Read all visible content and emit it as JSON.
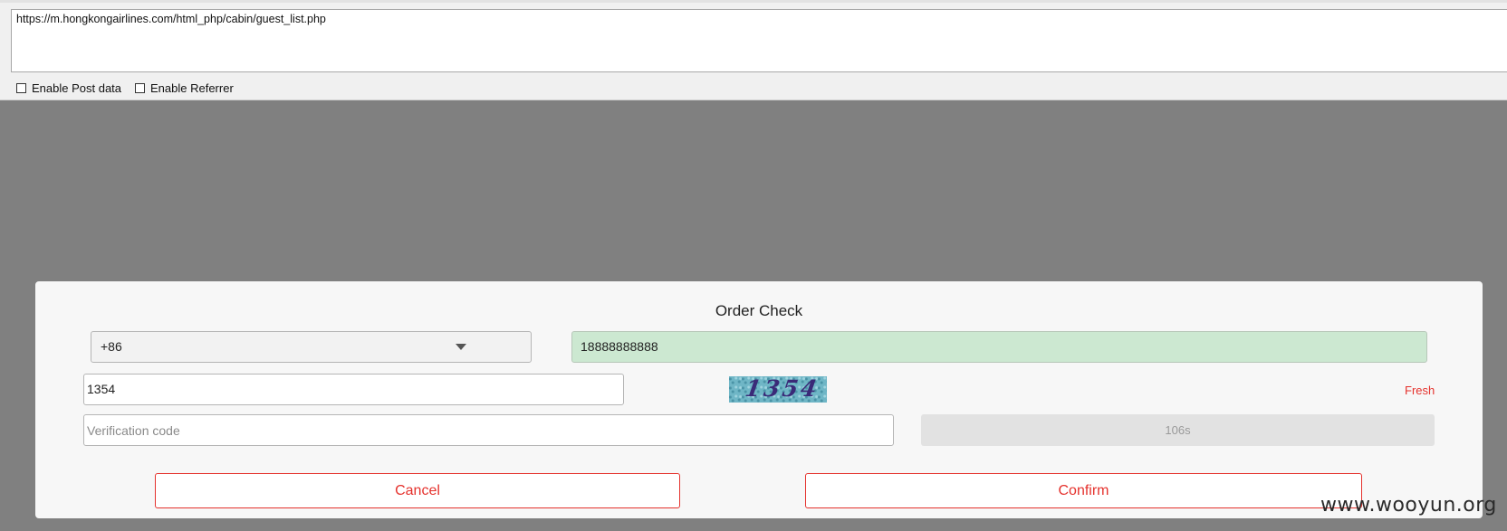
{
  "toolbar": {
    "url": "https://m.hongkongairlines.com/html_php/cabin/guest_list.php",
    "enable_post_label": "Enable Post data",
    "enable_referrer_label": "Enable Referrer",
    "enable_post_checked": false,
    "enable_referrer_checked": false
  },
  "dialog": {
    "title": "Order Check",
    "country_code": "+86",
    "phone": "18888888888",
    "captcha_value": "1354",
    "captcha_image_text": "1354",
    "fresh_label": "Fresh",
    "verification_placeholder": "Verification code",
    "countdown": "106s",
    "cancel_label": "Cancel",
    "confirm_label": "Confirm"
  },
  "watermark": "www.wooyun.org",
  "colors": {
    "accent": "#e5322d",
    "overlay": "#808080",
    "phone_field_bg": "#cce8d1"
  },
  "icons": {
    "dropdown": "triangle-down-icon"
  }
}
